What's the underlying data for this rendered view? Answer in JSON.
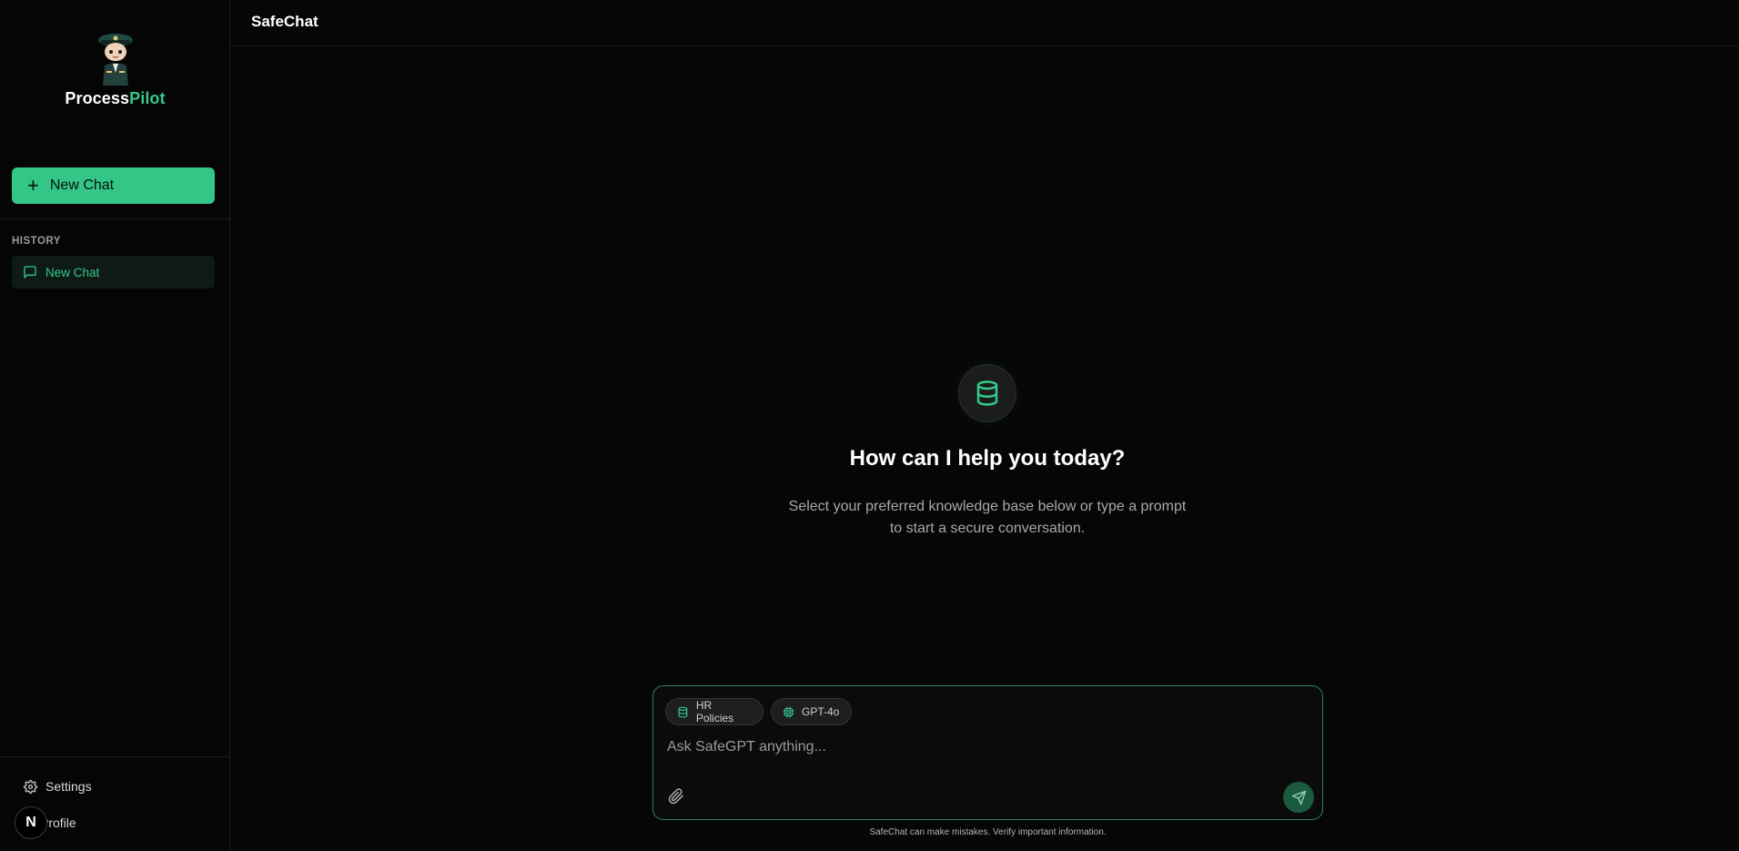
{
  "sidebar": {
    "brand_part1": "Process",
    "brand_part2": "Pilot",
    "new_chat_label": "New Chat",
    "history_label": "HISTORY",
    "history_items": [
      {
        "label": "New Chat",
        "icon": "message-icon",
        "active": true
      }
    ],
    "settings_label": "Settings",
    "profile_label": "Profile",
    "avatar_initial": "N"
  },
  "header": {
    "title": "SafeChat"
  },
  "main": {
    "hero_icon": "database-icon",
    "hero_title": "How can I help you today?",
    "hero_sub_line1": "Select your preferred knowledge base below or type a prompt",
    "hero_sub_line2": "to start a secure conversation."
  },
  "composer": {
    "knowledge_base_chip": "HR Policies",
    "model_chip": "GPT-4o",
    "placeholder": "Ask SafeGPT anything...",
    "value": "",
    "disclaimer": "SafeChat can make mistakes. Verify important information."
  },
  "colors": {
    "accent": "#34c98b",
    "background": "#060606",
    "composer_border": "#2f7f5c",
    "send_button": "#1c5a40"
  }
}
